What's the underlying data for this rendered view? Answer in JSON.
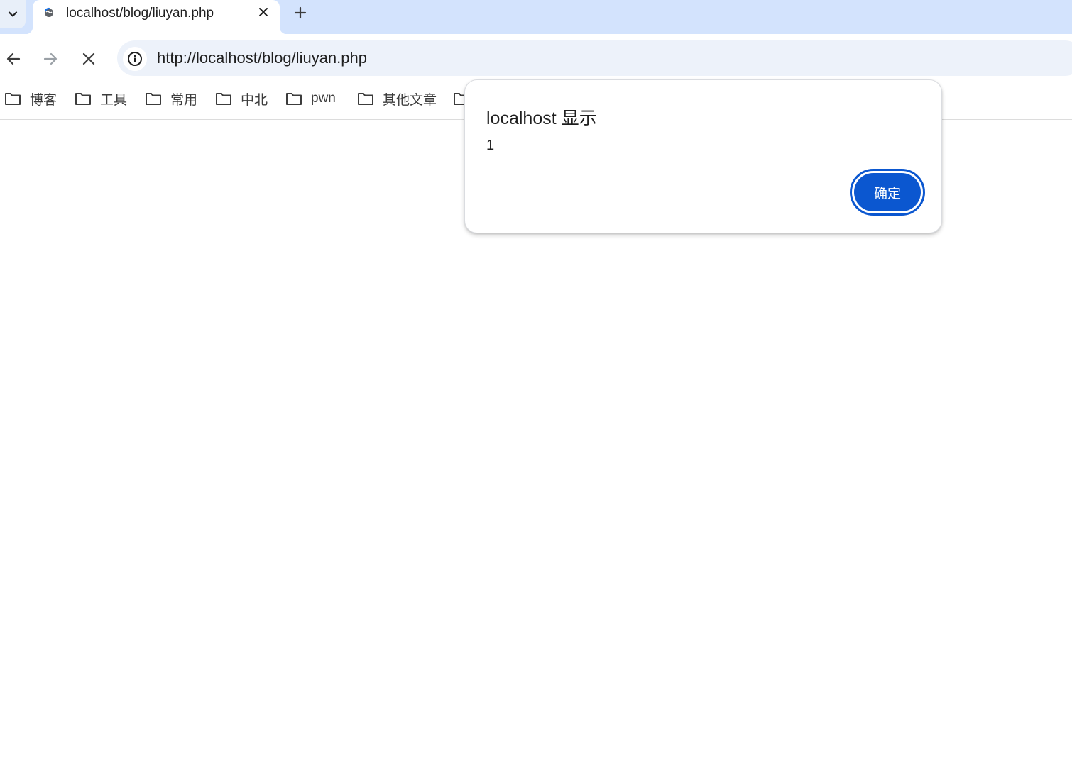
{
  "browser": {
    "tab": {
      "title": "localhost/blog/liuyan.php",
      "favicon": "loading-globe-icon"
    },
    "omnibox": {
      "url": "http://localhost/blog/liuyan.php"
    },
    "bookmarks": [
      {
        "label": "博客",
        "icon": "folder-icon"
      },
      {
        "label": "工具",
        "icon": "folder-icon"
      },
      {
        "label": "常用",
        "icon": "folder-icon"
      },
      {
        "label": "中北",
        "icon": "folder-icon"
      },
      {
        "label": "pwn",
        "icon": "folder-icon"
      },
      {
        "label": "其他文章",
        "icon": "folder-icon"
      },
      {
        "label": "",
        "icon": "folder-icon"
      }
    ]
  },
  "dialog": {
    "title": "localhost 显示",
    "message": "1",
    "ok_label": "确定"
  },
  "colors": {
    "tabstrip": "#d3e3fd",
    "omnibox": "#edf2fa",
    "accent": "#0b57d0"
  }
}
